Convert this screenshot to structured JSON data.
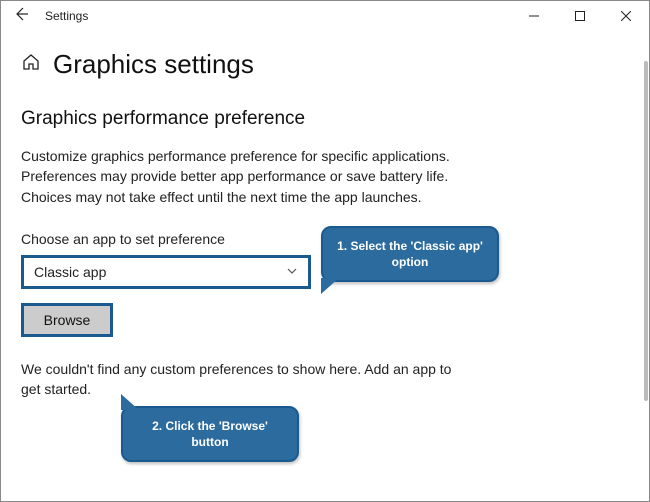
{
  "titlebar": {
    "back": "←",
    "title": "Settings"
  },
  "header": {
    "page_title": "Graphics settings"
  },
  "section": {
    "title": "Graphics performance preference",
    "description": "Customize graphics performance preference for specific applications. Preferences may provide better app performance or save battery life. Choices may not take effect until the next time the app launches.",
    "choose_label": "Choose an app to set preference",
    "dropdown_value": "Classic app",
    "browse_label": "Browse",
    "empty_text": "We couldn't find any custom preferences to show here. Add an app to get started."
  },
  "callouts": {
    "c1": "1. Select the 'Classic app' option",
    "c2": "2. Click the 'Browse' button"
  }
}
